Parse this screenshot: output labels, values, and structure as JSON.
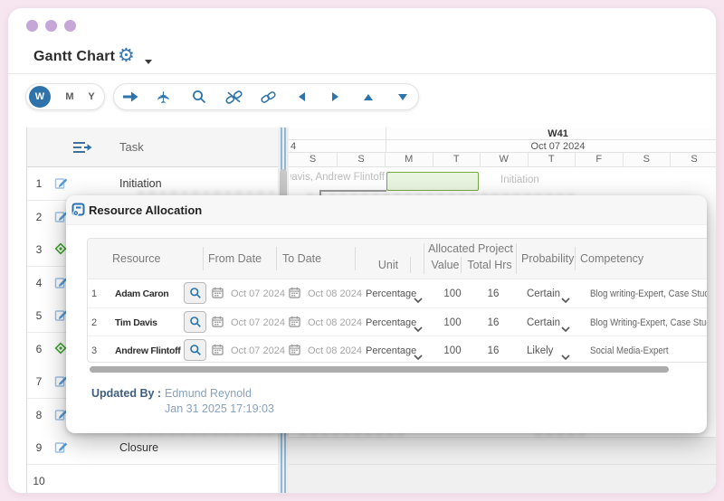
{
  "window": {
    "title": "Gantt Chart"
  },
  "toolbar": {
    "views": {
      "week": "W",
      "month": "M",
      "year": "Y"
    }
  },
  "gantt": {
    "task_column_label": "Task",
    "rows": [
      {
        "num": "1",
        "icon": "edit",
        "task": "Initiation"
      },
      {
        "num": "2",
        "icon": "edit",
        "task": ""
      },
      {
        "num": "3",
        "icon": "milestone",
        "task": ""
      },
      {
        "num": "4",
        "icon": "edit",
        "task": ""
      },
      {
        "num": "5",
        "icon": "edit",
        "task": ""
      },
      {
        "num": "6",
        "icon": "milestone",
        "task": ""
      },
      {
        "num": "7",
        "icon": "edit",
        "task": ""
      },
      {
        "num": "8",
        "icon": "edit",
        "task": ""
      },
      {
        "num": "9",
        "icon": "edit",
        "task": "Closure"
      },
      {
        "num": "10",
        "icon": "none",
        "task": ""
      }
    ],
    "timeline": {
      "week_label": "W41",
      "date_label": "Oct 07 2024",
      "prev_date_fragment": "4",
      "days": [
        "S",
        "S",
        "M",
        "T",
        "W",
        "T",
        "F",
        "S",
        "S"
      ],
      "row1": {
        "resources": "Davis, Andrew Flintoff",
        "bar_label": "Initiation"
      }
    }
  },
  "modal": {
    "title": "Resource Allocation",
    "headers": {
      "resource": "Resource",
      "from": "From Date",
      "to": "To Date",
      "unit": "Unit",
      "allocated": "Allocated Project",
      "value": "Value",
      "total_hrs": "Total Hrs",
      "probability": "Probability",
      "competency": "Competency"
    },
    "rows": [
      {
        "num": "1",
        "resource": "Adam Caron",
        "from": "Oct 07 2024",
        "to": "Oct 08 2024",
        "unit": "Percentage",
        "value": "100",
        "total_hrs": "16",
        "probability": "Certain",
        "competency": "Blog writing-Expert, Case Studie"
      },
      {
        "num": "2",
        "resource": "Tim Davis",
        "from": "Oct 07 2024",
        "to": "Oct 08 2024",
        "unit": "Percentage",
        "value": "100",
        "total_hrs": "16",
        "probability": "Certain",
        "competency": "Blog Writing-Expert, Case Studi"
      },
      {
        "num": "3",
        "resource": "Andrew Flintoff",
        "from": "Oct 07 2024",
        "to": "Oct 08 2024",
        "unit": "Percentage",
        "value": "100",
        "total_hrs": "16",
        "probability": "Likely",
        "competency": "Social Media-Expert"
      }
    ],
    "footer": {
      "label": "Updated By :",
      "name": "Edmund Reynold",
      "timestamp": "Jan 31 2025 17:19:03"
    }
  }
}
